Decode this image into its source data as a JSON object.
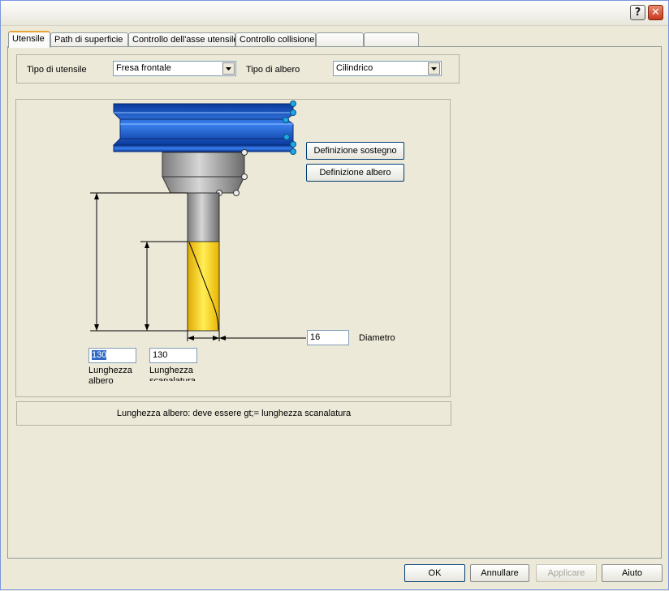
{
  "titlebar": {
    "help_icon": "question-mark-icon",
    "close_icon": "close-icon"
  },
  "tabs": [
    {
      "label": "Utensile",
      "active": true
    },
    {
      "label": "Path di superficie",
      "active": false
    },
    {
      "label": "Controllo dell'asse utensile",
      "active": false
    },
    {
      "label": "Controllo collisione",
      "active": false
    },
    {
      "label": "",
      "active": false
    },
    {
      "label": "",
      "active": false
    }
  ],
  "tool_type": {
    "label": "Tipo di utensile",
    "value": "Fresa frontale"
  },
  "shaft_type": {
    "label": "Tipo di albero",
    "value": "Cilindrico"
  },
  "buttons": {
    "holder_definition": "Definizione sostegno",
    "shaft_definition": "Definizione albero"
  },
  "diameter": {
    "value": "16",
    "label": "Diametro"
  },
  "shaft_length": {
    "value": "130",
    "label_line1": "Lunghezza",
    "label_line2": "albero"
  },
  "flute_length": {
    "value": "130",
    "label_line1": "Lunghezza",
    "label_line2": "scanalatura"
  },
  "status_message": "Lunghezza albero: deve essere gt;= lunghezza scanalatura",
  "footer": {
    "ok": "OK",
    "cancel": "Annullare",
    "apply": "Applicare",
    "help": "Aiuto"
  },
  "colors": {
    "holder_blue": "#1a56c8",
    "flute_yellow": "#ffd400",
    "shank_gray": "#a0a0a0",
    "handle_blue": "#1ea7e8"
  }
}
